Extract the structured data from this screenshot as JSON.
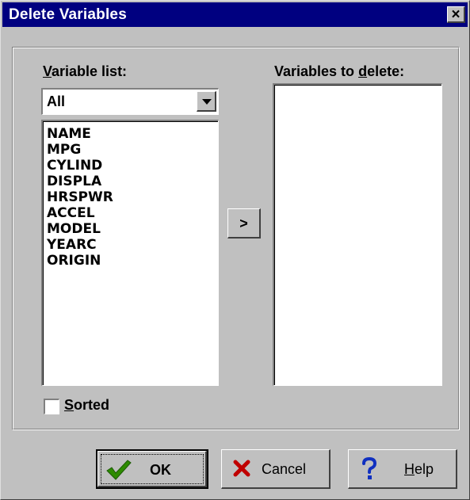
{
  "window": {
    "title": "Delete Variables"
  },
  "variable_list": {
    "label_prefix": "",
    "label_mnemonic": "V",
    "label_rest": "ariable list:",
    "filter_value": "All",
    "items": [
      "NAME",
      "MPG",
      "CYLIND",
      "DISPLA",
      "HRSPWR",
      "ACCEL",
      "MODEL",
      "YEARC",
      "ORIGIN"
    ]
  },
  "delete_list": {
    "label_prefix": "Variables to ",
    "label_mnemonic": "d",
    "label_rest": "elete:",
    "items": []
  },
  "move_button": {
    "label": ">"
  },
  "sorted": {
    "mnemonic": "S",
    "rest": "orted",
    "checked": false
  },
  "buttons": {
    "ok": "OK",
    "cancel": "Cancel",
    "help_mnemonic": "H",
    "help_rest": "elp"
  },
  "icons": {
    "close": "close-icon",
    "ok": "checkmark-icon",
    "cancel": "x-icon",
    "help": "question-mark-icon",
    "dropdown": "chevron-down-icon"
  },
  "colors": {
    "titlebar": "#000080",
    "face": "#c0c0c0",
    "ok_check": "#2e8b00",
    "cancel_x": "#c00000",
    "help_q": "#1030c0"
  }
}
